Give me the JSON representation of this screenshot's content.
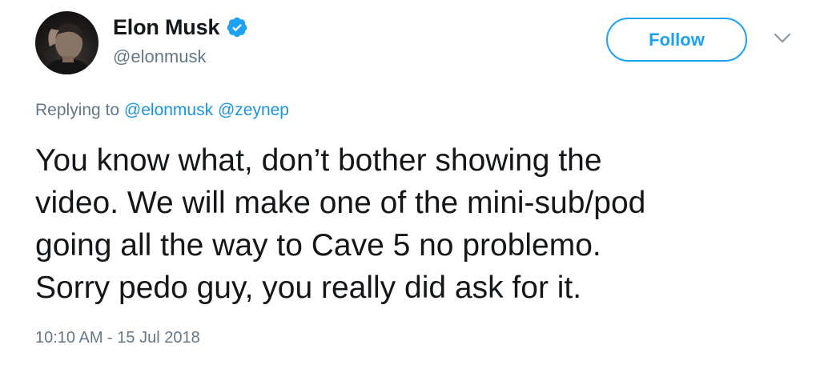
{
  "author": {
    "display_name": "Elon Musk",
    "handle": "@elonmusk",
    "verified_icon": "verified-badge-icon",
    "avatar_icon": "profile-avatar"
  },
  "actions": {
    "follow_label": "Follow",
    "more_icon": "chevron-down-icon"
  },
  "reply": {
    "prefix": "Replying to",
    "mentions": [
      "@elonmusk",
      "@zeynep"
    ]
  },
  "tweet": {
    "lines": [
      "You know what, don’t bother showing the",
      "video. We will make one of the mini-sub/pod",
      "going all the way to Cave 5 no problemo.",
      "Sorry pedo guy, you really did ask for it."
    ],
    "timestamp": "10:10 AM - 15 Jul 2018"
  },
  "colors": {
    "accent": "#1da1f2",
    "link": "#1b95e0",
    "secondary_text": "#657786",
    "primary_text": "#14171a"
  }
}
